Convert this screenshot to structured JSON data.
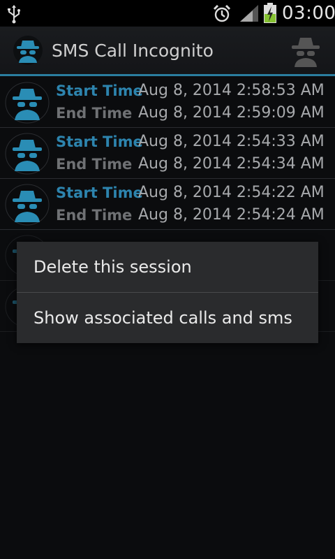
{
  "status_bar": {
    "time": "03:00",
    "icons": [
      "usb-icon",
      "alarm-icon",
      "signal-icon",
      "battery-charging-icon"
    ]
  },
  "action_bar": {
    "title": "SMS Call Incognito",
    "app_icon": "incognito-spy-icon",
    "menu_icon": "incognito-spy-icon"
  },
  "sessions": [
    {
      "start_label": "Start Time",
      "start": "Aug 8, 2014 2:58:53 AM",
      "end_label": "End Time",
      "end": "Aug 8, 2014 2:59:09 AM"
    },
    {
      "start_label": "Start Time",
      "start": "Aug 8, 2014 2:54:33 AM",
      "end_label": "End Time",
      "end": "Aug 8, 2014 2:54:34 AM"
    },
    {
      "start_label": "Start Time",
      "start": "Aug 8, 2014 2:54:22 AM",
      "end_label": "End Time",
      "end": "Aug 8, 2014 2:54:24 AM"
    }
  ],
  "context_menu": {
    "items": [
      "Delete this session",
      "Show associated calls and sms"
    ]
  },
  "colors": {
    "accent": "#2b7ea0",
    "label_start": "#2d84ae",
    "label_end": "#6f7174"
  }
}
